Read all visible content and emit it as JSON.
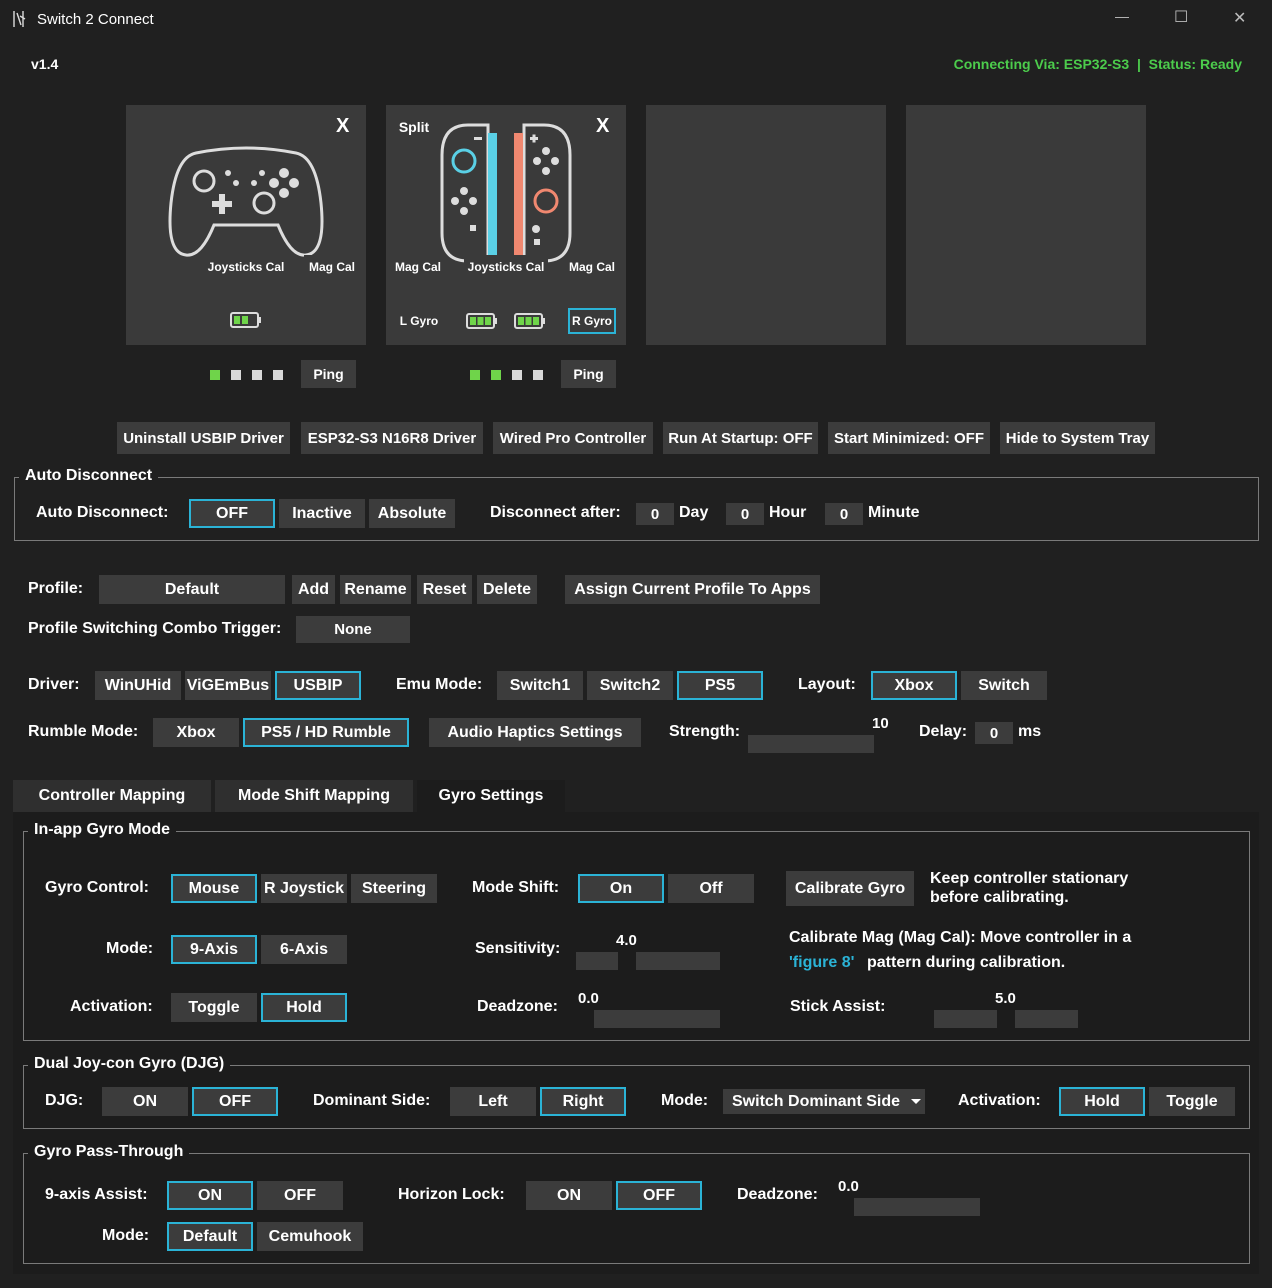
{
  "window": {
    "title": "Switch 2 Connect",
    "minimize": "—",
    "maximize": "☐",
    "close": "✕"
  },
  "version": "v1.4",
  "status": {
    "text": "Connecting Via: ESP32-S3  |  Status: Ready",
    "color": "#4ccc4c"
  },
  "cards": {
    "pro": {
      "close": "X",
      "joysticks_cal": "Joysticks Cal",
      "mag_cal": "Mag Cal",
      "ping": "Ping",
      "leds": [
        true,
        false,
        false,
        false
      ]
    },
    "joycons": {
      "split": "Split",
      "close": "X",
      "mag_cal_left": "Mag Cal",
      "joysticks_cal": "Joysticks Cal",
      "mag_cal_right": "Mag Cal",
      "l_gyro": "L Gyro",
      "r_gyro": "R Gyro",
      "ping": "Ping",
      "leds": [
        true,
        true,
        false,
        false
      ]
    }
  },
  "toolbar": {
    "uninstall": "Uninstall USBIP Driver",
    "esp_driver": "ESP32-S3 N16R8 Driver",
    "wired": "Wired Pro Controller",
    "startup": "Run At Startup: OFF",
    "minimized": "Start Minimized: OFF",
    "tray": "Hide to System Tray"
  },
  "auto_disconnect": {
    "group": "Auto Disconnect",
    "label": "Auto Disconnect:",
    "off": "OFF",
    "inactive": "Inactive",
    "absolute": "Absolute",
    "after": "Disconnect after:",
    "day_val": "0",
    "day": "Day",
    "hour_val": "0",
    "hour": "Hour",
    "minute_val": "0",
    "minute": "Minute"
  },
  "profile": {
    "label": "Profile:",
    "value": "Default",
    "add": "Add",
    "rename": "Rename",
    "reset": "Reset",
    "delete": "Delete",
    "assign": "Assign Current Profile To Apps",
    "combo_label": "Profile Switching Combo Trigger:",
    "combo_value": "None"
  },
  "driver": {
    "label": "Driver:",
    "winuhid": "WinUHid",
    "vigem": "ViGEmBus",
    "usbip": "USBIP",
    "emu_label": "Emu Mode:",
    "switch1": "Switch1",
    "switch2": "Switch2",
    "ps5": "PS5",
    "layout_label": "Layout:",
    "xbox": "Xbox",
    "switch": "Switch"
  },
  "rumble": {
    "label": "Rumble Mode:",
    "xbox": "Xbox",
    "ps5": "PS5 / HD Rumble",
    "haptics": "Audio Haptics Settings",
    "strength_label": "Strength:",
    "strength_value": "10",
    "delay_label": "Delay:",
    "delay_value": "0",
    "delay_unit": "ms"
  },
  "tabs": {
    "mapping": "Controller Mapping",
    "mode_shift": "Mode Shift Mapping",
    "gyro": "Gyro Settings"
  },
  "inapp": {
    "group": "In-app Gyro Mode",
    "control_label": "Gyro Control:",
    "mouse": "Mouse",
    "rjoystick": "R Joystick",
    "steering": "Steering",
    "modeshift_label": "Mode Shift:",
    "on": "On",
    "off": "Off",
    "calibrate": "Calibrate Gyro",
    "calib_note1": "Keep controller stationary",
    "calib_note2": "before calibrating.",
    "mode_label": "Mode:",
    "nine_axis": "9-Axis",
    "six_axis": "6-Axis",
    "sens_label": "Sensitivity:",
    "sens_value": "4.0",
    "mag_note1": "Calibrate Mag (Mag Cal): Move controller in a",
    "mag_note_link": "'figure 8'",
    "mag_note2": "pattern during calibration.",
    "activation_label": "Activation:",
    "toggle": "Toggle",
    "hold": "Hold",
    "deadzone_label": "Deadzone:",
    "deadzone_value": "0.0",
    "stick_label": "Stick Assist:",
    "stick_value": "5.0"
  },
  "djg": {
    "group": "Dual Joy-con Gyro (DJG)",
    "label": "DJG:",
    "on": "ON",
    "off": "OFF",
    "dominant_label": "Dominant Side:",
    "left": "Left",
    "right": "Right",
    "mode_label": "Mode:",
    "mode_value": "Switch Dominant Side",
    "activation_label": "Activation:",
    "hold": "Hold",
    "toggle": "Toggle"
  },
  "pass": {
    "group": "Gyro Pass-Through",
    "assist_label": "9-axis Assist:",
    "on": "ON",
    "off": "OFF",
    "horizon_label": "Horizon Lock:",
    "h_on": "ON",
    "h_off": "OFF",
    "deadzone_label": "Deadzone:",
    "deadzone_value": "0.0",
    "mode_label": "Mode:",
    "default": "Default",
    "cemuhook": "Cemuhook"
  },
  "colors": {
    "accent": "#2bb3d6",
    "led_on": "#6fd44a",
    "led_off": "#d8d8d8",
    "joycon_left": "#5ad0e6",
    "joycon_right": "#f08870"
  }
}
